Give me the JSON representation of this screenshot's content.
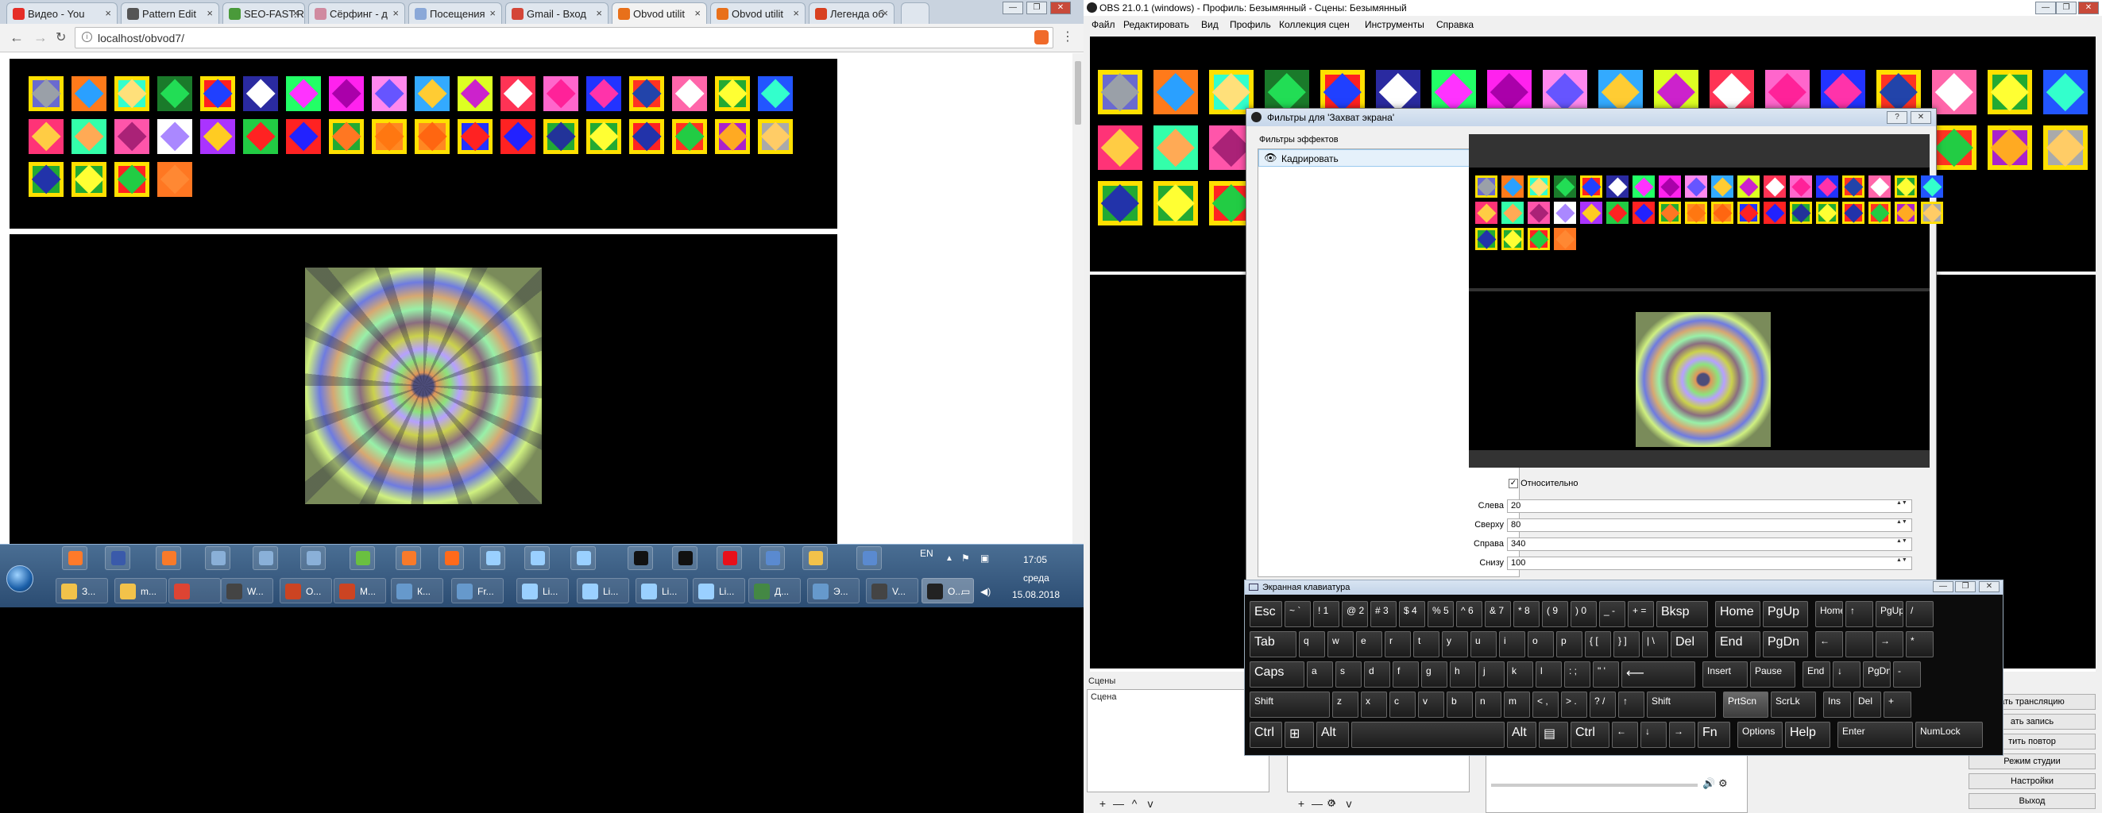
{
  "browser": {
    "tabs": [
      {
        "label": "Видео - You",
        "color": "#e52d27"
      },
      {
        "label": "Pattern Edit",
        "color": "#555555"
      },
      {
        "label": "SEO-FAST.R",
        "color": "#4a9a3a"
      },
      {
        "label": "Сёрфинг - д",
        "color": "#d08aa0"
      },
      {
        "label": "Посещения",
        "color": "#8aa8d8"
      },
      {
        "label": "Gmail - Вход",
        "color": "#d44638"
      },
      {
        "label": "Obvod utilit",
        "color": "#e8701a"
      },
      {
        "label": "Obvod utilit",
        "color": "#e8701a"
      },
      {
        "label": "Легенда об",
        "color": "#d84020"
      }
    ],
    "url": "localhost/obvod7/",
    "window_controls": [
      "—",
      "❐",
      "✕"
    ]
  },
  "thumbnails": {
    "row1": [
      {
        "selected": true,
        "bg": "#6a6ad0",
        "fg": "#9aa0a8"
      },
      {
        "selected": false,
        "bg": "#ff7a1a",
        "fg": "#2aa0ff"
      },
      {
        "selected": true,
        "bg": "#33ffcc",
        "fg": "#ffe07a"
      },
      {
        "selected": false,
        "bg": "#1a7a2a",
        "fg": "#22dd55"
      },
      {
        "selected": true,
        "bg": "#ff2020",
        "fg": "#2040ff"
      },
      {
        "selected": false,
        "bg": "#2a2aa0",
        "fg": "#ffffff"
      },
      {
        "selected": false,
        "bg": "#22ff66",
        "fg": "#ff33ff"
      },
      {
        "selected": false,
        "bg": "#ff22ee",
        "fg": "#aa00aa"
      },
      {
        "selected": false,
        "bg": "#ff88ee",
        "fg": "#6655ff"
      },
      {
        "selected": false,
        "bg": "#33aaff",
        "fg": "#ffcc33"
      },
      {
        "selected": false,
        "bg": "#ddff22",
        "fg": "#cc22cc"
      },
      {
        "selected": false,
        "bg": "#ff3355",
        "fg": "#ffffff"
      },
      {
        "selected": false,
        "bg": "#ff66cc",
        "fg": "#ff2299"
      },
      {
        "selected": false,
        "bg": "#2233ff",
        "fg": "#ff33aa"
      },
      {
        "selected": true,
        "bg": "#ff3322",
        "fg": "#2244aa"
      },
      {
        "selected": false,
        "bg": "#ff66aa",
        "fg": "#ffffff"
      },
      {
        "selected": true,
        "bg": "#22aa33",
        "fg": "#ffff33"
      },
      {
        "selected": false,
        "bg": "#2255ff",
        "fg": "#33ffcc"
      }
    ],
    "row2": [
      {
        "selected": false,
        "bg": "#ff3377",
        "fg": "#ffcc44"
      },
      {
        "selected": false,
        "bg": "#33ffaa",
        "fg": "#ffaa55"
      },
      {
        "selected": false,
        "bg": "#ff55aa",
        "fg": "#aa2277"
      },
      {
        "selected": false,
        "bg": "#ffffff",
        "fg": "#aa88ff"
      },
      {
        "selected": false,
        "bg": "#aa33ff",
        "fg": "#ffcc22"
      },
      {
        "selected": false,
        "bg": "#22cc44",
        "fg": "#ff2222"
      },
      {
        "selected": false,
        "bg": "#ff2222",
        "fg": "#2222ff"
      },
      {
        "selected": true,
        "bg": "#22aa33",
        "fg": "#ff7722"
      },
      {
        "selected": true,
        "bg": "#ff8822",
        "fg": "#ff7711"
      },
      {
        "selected": true,
        "bg": "#ff8822",
        "fg": "#ff6611"
      },
      {
        "selected": true,
        "bg": "#2233ff",
        "fg": "#ff2222"
      },
      {
        "selected": false,
        "bg": "#ff2222",
        "fg": "#2222ff"
      },
      {
        "selected": true,
        "bg": "#22aa33",
        "fg": "#223399"
      },
      {
        "selected": true,
        "bg": "#22aa33",
        "fg": "#ffff33"
      },
      {
        "selected": true,
        "bg": "#ff2222",
        "fg": "#2233aa"
      },
      {
        "selected": true,
        "bg": "#ff3322",
        "fg": "#22cc44"
      },
      {
        "selected": true,
        "bg": "#aa22cc",
        "fg": "#ffaa22"
      },
      {
        "selected": true,
        "bg": "#aaaaaa",
        "fg": "#ffcc66"
      }
    ],
    "row3": [
      {
        "selected": true,
        "bg": "#22aa33",
        "fg": "#2233aa"
      },
      {
        "selected": true,
        "bg": "#22aa33",
        "fg": "#ffff33"
      },
      {
        "selected": true,
        "bg": "#ff2222",
        "fg": "#22cc44"
      },
      {
        "selected": false,
        "bg": "#ff7722",
        "fg": "#ff8833"
      }
    ]
  },
  "taskbar": {
    "pinned": [
      {
        "name": "media-player-icon",
        "color": "#ff7a2a"
      },
      {
        "name": "save-icon",
        "color": "#3a5aaa"
      },
      {
        "name": "xampp-icon",
        "color": "#f87a2a"
      },
      {
        "name": "paint-icon",
        "color": "#8ab0d8"
      },
      {
        "name": "paint-icon-2",
        "color": "#8ab0d8"
      },
      {
        "name": "paint-icon-3",
        "color": "#8ab0d8"
      },
      {
        "name": "chart-icon",
        "color": "#6ac040"
      },
      {
        "name": "xampp-icon-2",
        "color": "#f87a2a"
      },
      {
        "name": "firefox-icon",
        "color": "#ff6a1a"
      },
      {
        "name": "app-icon-1",
        "color": "#9ad0ff"
      },
      {
        "name": "app-icon-2",
        "color": "#9ad0ff"
      },
      {
        "name": "app-icon-3",
        "color": "#9ad0ff"
      },
      {
        "name": "cmd-icon",
        "color": "#111111"
      },
      {
        "name": "cmd-icon-2",
        "color": "#111111"
      },
      {
        "name": "opera-icon",
        "color": "#e8101a"
      },
      {
        "name": "network-icon",
        "color": "#5a8ad0"
      },
      {
        "name": "folder-icon",
        "color": "#f2c24a"
      },
      {
        "name": "device-icon",
        "color": "#5a8ad0"
      }
    ],
    "tasks": [
      {
        "label": "З...",
        "color": "#f2c24a"
      },
      {
        "label": "m...",
        "color": "#f2c24a"
      },
      {
        "label": "",
        "color": "#dd4433"
      },
      {
        "label": "W...",
        "color": "#444444"
      },
      {
        "label": "О...",
        "color": "#cc4422"
      },
      {
        "label": "M...",
        "color": "#cc4422"
      },
      {
        "label": "К...",
        "color": "#6699cc"
      },
      {
        "label": "Fr...",
        "color": "#6699cc"
      },
      {
        "label": "Li...",
        "color": "#9ad0ff"
      },
      {
        "label": "Li...",
        "color": "#9ad0ff"
      },
      {
        "label": "Li...",
        "color": "#9ad0ff"
      },
      {
        "label": "Li...",
        "color": "#9ad0ff"
      },
      {
        "label": "Д...",
        "color": "#448844"
      },
      {
        "label": "Э...",
        "color": "#6699cc"
      },
      {
        "label": "V...",
        "color": "#444444"
      },
      {
        "label": "O...",
        "color": "#222222"
      }
    ],
    "lang": "EN",
    "time": "17:05",
    "day": "среда",
    "date": "15.08.2018"
  },
  "obs": {
    "title": "OBS 21.0.1 (windows) - Профиль: Безымянный - Сцены: Безымянный",
    "menu": [
      "Файл",
      "Редактировать",
      "Вид",
      "Профиль",
      "Коллекция сцен",
      "Инструменты",
      "Справка"
    ],
    "scenes_label": "Сцены",
    "scene_item": "Сцена",
    "side_buttons": [
      "ать трансляцию",
      "ать запись",
      "тить повтор",
      "Режим студии",
      "Настройки",
      "Выход"
    ],
    "dock_controls": [
      "+",
      "—",
      "^",
      "v"
    ]
  },
  "filters": {
    "title": "Фильтры для 'Захват экрана'",
    "effects_label": "Фильтры эффектов",
    "filter_item": "Кадрировать",
    "relative_label": "Относительно",
    "fields": [
      {
        "label": "Слева",
        "value": "20"
      },
      {
        "label": "Сверху",
        "value": "80"
      },
      {
        "label": "Справа",
        "value": "340"
      },
      {
        "label": "Снизу",
        "value": "100"
      }
    ],
    "title_buttons": [
      "?",
      "✕"
    ]
  },
  "keyboard": {
    "title": "Экранная клавиатура",
    "rows": [
      [
        "Esc",
        "~ `",
        "! 1",
        "@ 2",
        "# 3",
        "$ 4",
        "% 5",
        "^ 6",
        "& 7",
        "* 8",
        "( 9",
        ") 0",
        "_ -",
        "+ =",
        "Bksp",
        "Home",
        "PgUp",
        "Home",
        "↑",
        "PgUp",
        "/"
      ],
      [
        "Tab",
        "q",
        "w",
        "e",
        "r",
        "t",
        "y",
        "u",
        "i",
        "o",
        "p",
        "{ [",
        "} ]",
        "| \\",
        "Del",
        "End",
        "PgDn",
        "←",
        "",
        "→",
        "*"
      ],
      [
        "Caps",
        "a",
        "s",
        "d",
        "f",
        "g",
        "h",
        "j",
        "k",
        "l",
        ": ;",
        "\" '",
        "⟵",
        "Insert",
        "Pause",
        "End",
        "↓",
        "PgDn",
        "-"
      ],
      [
        "Shift",
        "z",
        "x",
        "c",
        "v",
        "b",
        "n",
        "m",
        "< ,",
        "> .",
        "? /",
        "↑",
        "Shift",
        "PrtScn",
        "ScrLk",
        "Ins",
        "Del",
        "+"
      ],
      [
        "Ctrl",
        "⊞",
        "Alt",
        "",
        "Alt",
        "▤",
        "Ctrl",
        "←",
        "↓",
        "→",
        "Fn",
        "Options",
        "Help",
        "Enter",
        "NumLock"
      ]
    ]
  }
}
